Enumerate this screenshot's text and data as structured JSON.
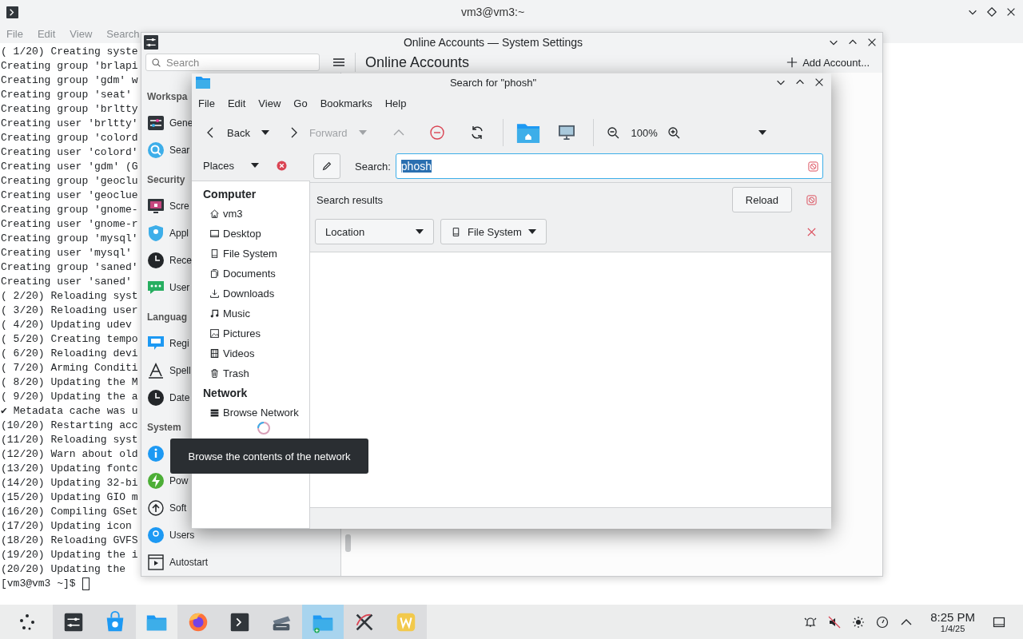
{
  "terminal": {
    "title": "vm3@vm3:~",
    "menu": [
      "File",
      "Edit",
      "View",
      "Search"
    ],
    "lines": [
      "( 1/20) Creating syste",
      "Creating group 'brlapi",
      "Creating group 'gdm' w",
      "Creating group 'seat'",
      "Creating group 'brltty",
      "Creating user 'brltty'",
      "Creating group 'colord",
      "Creating user 'colord'",
      "Creating user 'gdm' (G",
      "Creating group 'geoclu",
      "Creating user 'geoclue",
      "Creating group 'gnome-",
      "Creating user 'gnome-r",
      "Creating group 'mysql'",
      "Creating user 'mysql'",
      "Creating group 'saned'",
      "Creating user 'saned'",
      "( 2/20) Reloading syst",
      "( 3/20) Reloading user",
      "( 4/20) Updating udev",
      "( 5/20) Creating tempo",
      "( 6/20) Reloading devi",
      "( 7/20) Arming Conditi",
      "( 8/20) Updating the M",
      "( 9/20) Updating the a",
      "✔ Metadata cache was u",
      "(10/20) Restarting acc",
      "(11/20) Reloading syst",
      "(12/20) Warn about old",
      "(13/20) Updating fontc",
      "(14/20) Updating 32-bi",
      "(15/20) Updating GIO m",
      "(16/20) Compiling GSet",
      "(17/20) Updating icon",
      "(18/20) Reloading GVFS",
      "(19/20) Updating the i",
      "(20/20) Updating the"
    ],
    "prompt": "[vm3@vm3 ~]$"
  },
  "settings": {
    "title": "Online Accounts — System Settings",
    "search": {
      "placeholder": "Search"
    },
    "page_title": "Online Accounts",
    "add_button": "Add Account...",
    "sidebar": [
      {
        "kind": "heading",
        "label": "Workspa"
      },
      {
        "kind": "item",
        "label": "Gene"
      },
      {
        "kind": "item",
        "label": "Sear"
      },
      {
        "kind": "heading",
        "label": "Security"
      },
      {
        "kind": "item",
        "label": "Scre"
      },
      {
        "kind": "item",
        "label": "Appl"
      },
      {
        "kind": "item",
        "label": "Rece"
      },
      {
        "kind": "item",
        "label": "User"
      },
      {
        "kind": "heading",
        "label": "Languag"
      },
      {
        "kind": "item",
        "label": "Regi"
      },
      {
        "kind": "item",
        "label": "Spell"
      },
      {
        "kind": "item",
        "label": "Date"
      },
      {
        "kind": "heading",
        "label": "System"
      },
      {
        "kind": "item"
      },
      {
        "kind": "item",
        "label": "Pow"
      },
      {
        "kind": "item",
        "label": "Soft"
      },
      {
        "kind": "item",
        "label": "Users"
      },
      {
        "kind": "item",
        "label": "Autostart"
      }
    ]
  },
  "file_manager": {
    "title": "Search for \"phosh\"",
    "menu": [
      "File",
      "Edit",
      "View",
      "Go",
      "Bookmarks",
      "Help"
    ],
    "toolbar": {
      "back": {
        "label": "Back",
        "disabled": false
      },
      "forward": {
        "label": "Forward",
        "disabled": true
      },
      "up": {
        "disabled": true
      },
      "zoom": "100%"
    },
    "places": {
      "label": "Places",
      "tree": [
        {
          "label": "Computer",
          "children": [
            {
              "label": "vm3"
            },
            {
              "label": "Desktop"
            },
            {
              "label": "File System"
            },
            {
              "label": "Documents"
            },
            {
              "label": "Downloads"
            },
            {
              "label": "Music"
            },
            {
              "label": "Pictures"
            },
            {
              "label": "Videos"
            },
            {
              "label": "Trash"
            }
          ]
        },
        {
          "label": "Network",
          "children": [
            {
              "label": "Browse Network"
            }
          ]
        }
      ]
    },
    "search": {
      "label": "Search:",
      "value": "phosh",
      "selected": true
    },
    "results": {
      "label": "Search results",
      "reload": "Reload",
      "filters": [
        "Location",
        "File System"
      ]
    },
    "tooltip": "Browse the contents of the network"
  },
  "taskbar": {
    "tasks": [
      {
        "open": true,
        "selected": false
      },
      {
        "open": true,
        "selected": false
      },
      {
        "open": false,
        "selected": false
      },
      {
        "open": true,
        "selected": false
      },
      {
        "open": true,
        "selected": false
      },
      {
        "open": true,
        "selected": false
      },
      {
        "open": true,
        "selected": true
      },
      {
        "open": true,
        "selected": false
      },
      {
        "open": true,
        "selected": false
      }
    ],
    "clock": {
      "time": "8:25 PM",
      "date": "1/4/25"
    }
  }
}
